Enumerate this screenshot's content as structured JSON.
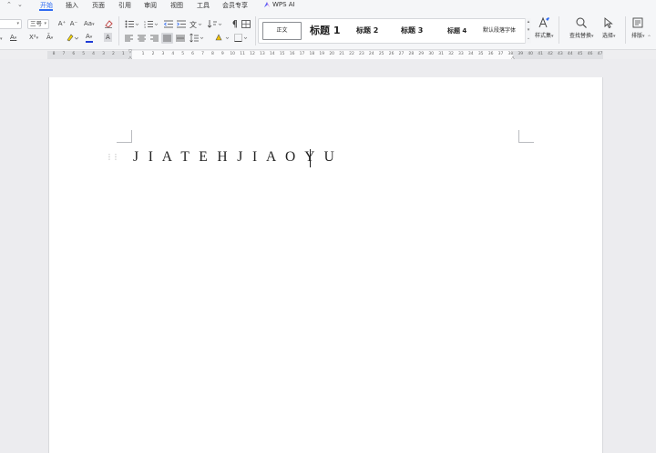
{
  "menu": {
    "tabs": [
      "开始",
      "插入",
      "页面",
      "引用",
      "审阅",
      "视图",
      "工具",
      "会员专享"
    ],
    "active_tab": "开始",
    "wps_ai": "WPS AI"
  },
  "ribbon": {
    "font_size": "三号",
    "styles": {
      "normal": "正文",
      "heading1": "标题 1",
      "heading2": "标题 2",
      "heading3": "标题 3",
      "heading4": "标题 4",
      "default_para_font": "默认段落字体"
    },
    "tools": {
      "style_set": "样式集",
      "find_replace": "查找替换",
      "select": "选择",
      "layout": "排版"
    },
    "icons": {
      "font_grow": "A⁺",
      "font_shrink": "A⁻",
      "change_case": "Aa",
      "clear_format": "eraser-icon",
      "superscript": "X²",
      "font_color_letter": "A",
      "char_shading": "A"
    }
  },
  "ruler": {
    "numbers": [
      "8",
      "7",
      "6",
      "5",
      "4",
      "3",
      "2",
      "1",
      "",
      "1",
      "2",
      "3",
      "4",
      "5",
      "6",
      "7",
      "8",
      "9",
      "10",
      "11",
      "12",
      "13",
      "14",
      "15",
      "16",
      "17",
      "18",
      "19",
      "20",
      "21",
      "22",
      "23",
      "24",
      "25",
      "26",
      "27",
      "28",
      "29",
      "30",
      "31",
      "32",
      "33",
      "34",
      "35",
      "36",
      "37",
      "38",
      "39",
      "40",
      "41",
      "42",
      "43",
      "44",
      "45",
      "46",
      "47"
    ]
  },
  "document": {
    "text": "J I A T E H J I A O Y U"
  },
  "colors": {
    "accent": "#2f6bf2",
    "font_color_bar": "#1f3bd6"
  }
}
